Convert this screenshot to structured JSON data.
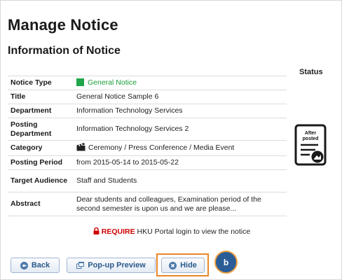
{
  "page": {
    "title": "Manage Notice",
    "section_title": "Information of Notice"
  },
  "status": {
    "header": "Status",
    "stamp_line1": "After",
    "stamp_line2": "posted"
  },
  "notice": {
    "type_label": "Notice Type",
    "type_value": "General Notice",
    "type_color": "#1fa64a",
    "title_label": "Title",
    "title_value": "General Notice Sample 6",
    "department_label": "Department",
    "department_value": "Information Technology Services",
    "posting_department_label": "Posting Department",
    "posting_department_value": "Information Technology Services 2",
    "category_label": "Category",
    "category_value": "Ceremony / Press Conference / Media Event",
    "posting_period_label": "Posting Period",
    "posting_period_value": "from 2015-05-14 to 2015-05-22",
    "target_audience_label": "Target Audience",
    "target_audience_value": "Staff and Students",
    "abstract_label": "Abstract",
    "abstract_value": "Dear students and colleagues, Examination period of the second semester is upon us and we are please..."
  },
  "require": {
    "keyword": "REQUIRE",
    "text": "HKU Portal login to view the notice"
  },
  "buttons": {
    "back": "Back",
    "popup_preview": "Pop-up Preview",
    "hide": "Hide"
  },
  "callout": {
    "label": "b"
  },
  "colors": {
    "accent_blue": "#2b5a8a",
    "highlight_orange": "#e8862b",
    "require_red": "#d00000"
  }
}
